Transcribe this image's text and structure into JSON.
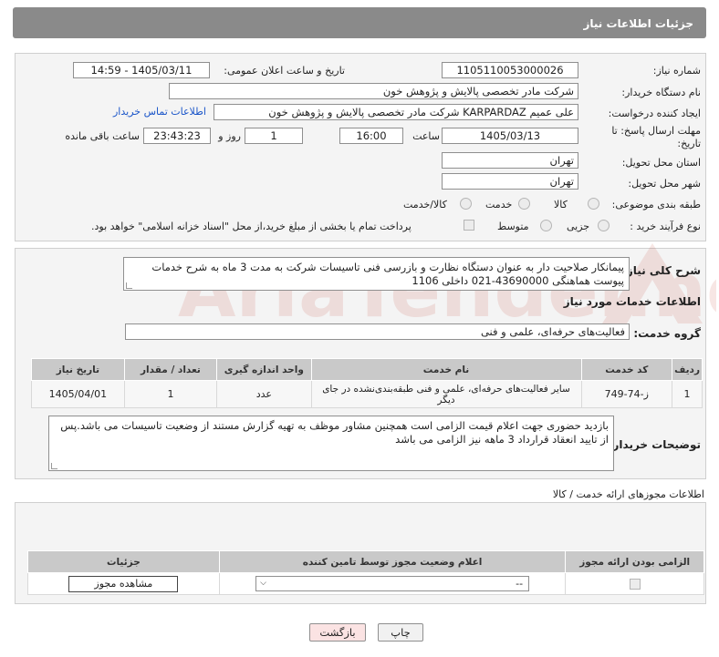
{
  "header": {
    "title": "جزئیات اطلاعات نیاز"
  },
  "form": {
    "need_number_label": "شماره نیاز:",
    "need_number": "1105110053000026",
    "announce_label": "تاریخ و ساعت اعلان عمومی:",
    "announce_value": "1405/03/11 - 14:59",
    "buyer_org_label": "نام دستگاه خریدار:",
    "buyer_org": "شرکت مادر تخصصی پالایش و پژوهش خون",
    "creator_label": "ایجاد کننده درخواست:",
    "creator": "علی عمیم KARPARDAZ شرکت مادر تخصصی پالایش و پژوهش خون",
    "buyer_contact_link": "اطلاعات تماس خریدار",
    "deadline_label_1": "مهلت ارسال پاسخ: تا",
    "deadline_label_2": "تاریخ:",
    "deadline_date": "1405/03/13",
    "time_label": "ساعت",
    "deadline_time": "16:00",
    "days_value": "1",
    "days_label": "روز و",
    "remaining_time": "23:43:23",
    "remaining_label": "ساعت باقی مانده",
    "province_label": "استان محل تحویل:",
    "province": "تهران",
    "city_label": "شهر محل تحویل:",
    "city": "تهران",
    "category_label": "طبقه بندی موضوعی:",
    "category_options": [
      "کالا",
      "خدمت",
      "کالا/خدمت"
    ],
    "process_label": "نوع فرآیند خرید :",
    "process_options": [
      "جزیی",
      "متوسط"
    ],
    "payment_note": "پرداخت تمام یا بخشی از مبلغ خرید،از محل \"اسناد خزانه اسلامی\" خواهد بود."
  },
  "details": {
    "summary_label": "شرح کلی نیاز:",
    "summary": "پیمانکار صلاحیت دار به عنوان دستگاه نظارت و بازرسی فنی تاسیسات شرکت به مدت 3 ماه به شرح خدمات پیوست هماهنگی 43690000-021 داخلی 1106",
    "services_heading": "اطلاعات خدمات مورد نیاز",
    "service_group_label": "گروه خدمت:",
    "service_group": "فعالیت‌های حرفه‌ای، علمی و فنی",
    "table": {
      "headers": [
        "ردیف",
        "کد خدمت",
        "نام خدمت",
        "واحد اندازه گیری",
        "تعداد / مقدار",
        "تاریخ نیاز"
      ],
      "rows": [
        [
          "1",
          "ز-74-749",
          "سایر فعالیت‌های حرفه‌ای، علمی و فنی طبقه‌بندی‌نشده در جای دیگر",
          "عدد",
          "1",
          "1405/04/01"
        ]
      ]
    },
    "buyer_notes_label": "توضیحات خریدار:",
    "buyer_notes": "بازدید حضوری جهت اعلام قیمت الزامی است همچنین مشاور موظف به تهیه گزارش مستند از وضعیت تاسیسات می باشد.پس از تایید انعقاد قرارداد 3 ماهه نیز الزامی می باشد"
  },
  "licenses": {
    "heading": "اطلاعات مجوزهای ارائه خدمت / کالا",
    "headers": [
      "الزامی بودن ارائه مجوز",
      "اعلام وضعیت مجوز توسط تامین کننده",
      "جزئیات"
    ],
    "select_value": "--",
    "view_button": "مشاهده مجوز"
  },
  "footer": {
    "print_button": "چاپ",
    "back_button": "بازگشت"
  },
  "watermark": "AriaTender.neT"
}
